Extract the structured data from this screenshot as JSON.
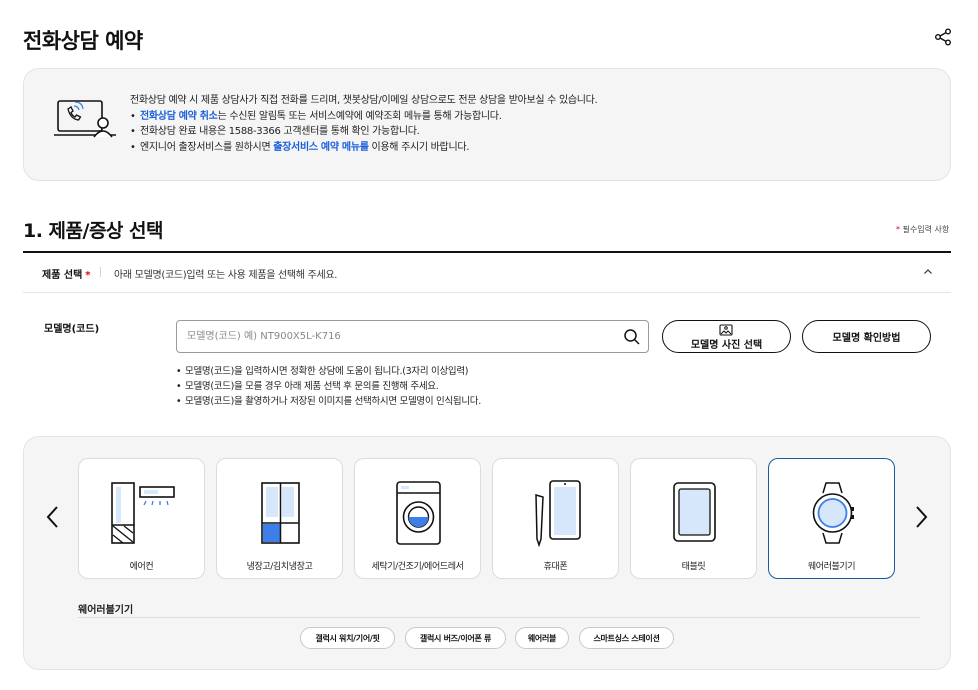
{
  "page_title": "전화상담 예약",
  "notice": {
    "intro": "전화상담 예약 시 제품 상담사가 직접 전화를 드리며, 챗봇상담/이메일 상담으로도 전문 상담을 받아보실 수 있습니다.",
    "item1_link": "전화상담 예약 취소",
    "item1_rest": "는 수신된 알림톡 또는 서비스예약에 예약조회 메뉴를 통해 가능합니다.",
    "item2": "전화상담 완료 내용은 1588-3366 고객센터를 통해 확인 가능합니다.",
    "item3_pre": "엔지니어 출장서비스를 원하시면 ",
    "item3_link": "출장서비스 예약 메뉴를",
    "item3_post": " 이용해 주시기 바랍니다."
  },
  "section": {
    "title": "1. 제품/증상 선택",
    "required_star": "*",
    "required_note": "필수입력 사항"
  },
  "product_row": {
    "label": "제품 선택",
    "star": "*",
    "desc": "아래 모델명(코드)입력 또는 사용 제품을 선택해 주세요."
  },
  "model": {
    "label": "모델명(코드)",
    "placeholder": "모델명(코드) 예) NT900X5L-K716",
    "value": "",
    "photo_button": "모델명 사진 선택",
    "guide_button": "모델명 확인방법"
  },
  "hints": [
    "모델명(코드)을 입력하시면 정확한 상담에 도움이 됩니다.(3자리 이상입력)",
    "모델명(코드)을 모를 경우 아래 제품 선택 후 문의를 진행해 주세요.",
    "모델명(코드)을 촬영하거나 저장된 이미지를 선택하시면 모델명이 인식됩니다."
  ],
  "categories": [
    {
      "label": "에어컨",
      "icon": "air-conditioner-icon",
      "selected": false
    },
    {
      "label": "냉장고/김치냉장고",
      "icon": "refrigerator-icon",
      "selected": false
    },
    {
      "label": "세탁기/건조기/에어드레서",
      "icon": "washing-machine-icon",
      "selected": false
    },
    {
      "label": "휴대폰",
      "icon": "mobile-phone-icon",
      "selected": false
    },
    {
      "label": "태블릿",
      "icon": "tablet-icon",
      "selected": false
    },
    {
      "label": "웨어러블기기",
      "icon": "smartwatch-icon",
      "selected": true
    }
  ],
  "subcategory": {
    "title": "웨어러블기기",
    "chips": [
      "갤럭시 워치/기어/핏",
      "갤럭시 버즈/이어폰 류",
      "웨어러블",
      "스마트싱스 스테이션"
    ]
  },
  "colors": {
    "accent_blue": "#1a5fdc",
    "icon_blue": "#3d7ee8",
    "required_red": "#e0001b",
    "selected_border": "#1a5b9e"
  }
}
